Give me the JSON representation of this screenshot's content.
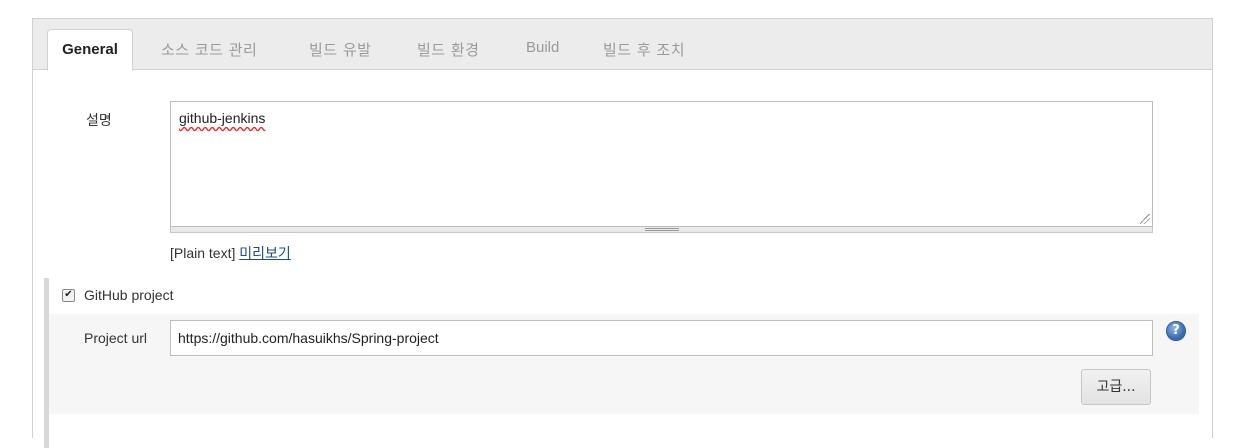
{
  "tabs": [
    {
      "label": "General",
      "active": true
    },
    {
      "label": "소스 코드 관리",
      "active": false
    },
    {
      "label": "빌드 유발",
      "active": false
    },
    {
      "label": "빌드 환경",
      "active": false
    },
    {
      "label": "Build",
      "active": false
    },
    {
      "label": "빌드 후 조치",
      "active": false
    }
  ],
  "description": {
    "label": "설명",
    "value": "github-jenkins",
    "format_text": "[Plain text]",
    "preview_link": "미리보기"
  },
  "github_project": {
    "checkbox_label": "GitHub project",
    "checked": true,
    "project_url_label": "Project url",
    "project_url_value": "https://github.com/hasuikhs/Spring-project",
    "help_icon_text": "?",
    "advanced_button": "고급..."
  },
  "colors": {
    "link": "#204a87",
    "help_icon": "#3d6fb5",
    "tabbar_bg": "#ececec",
    "section_bg": "#f6f6f6"
  }
}
